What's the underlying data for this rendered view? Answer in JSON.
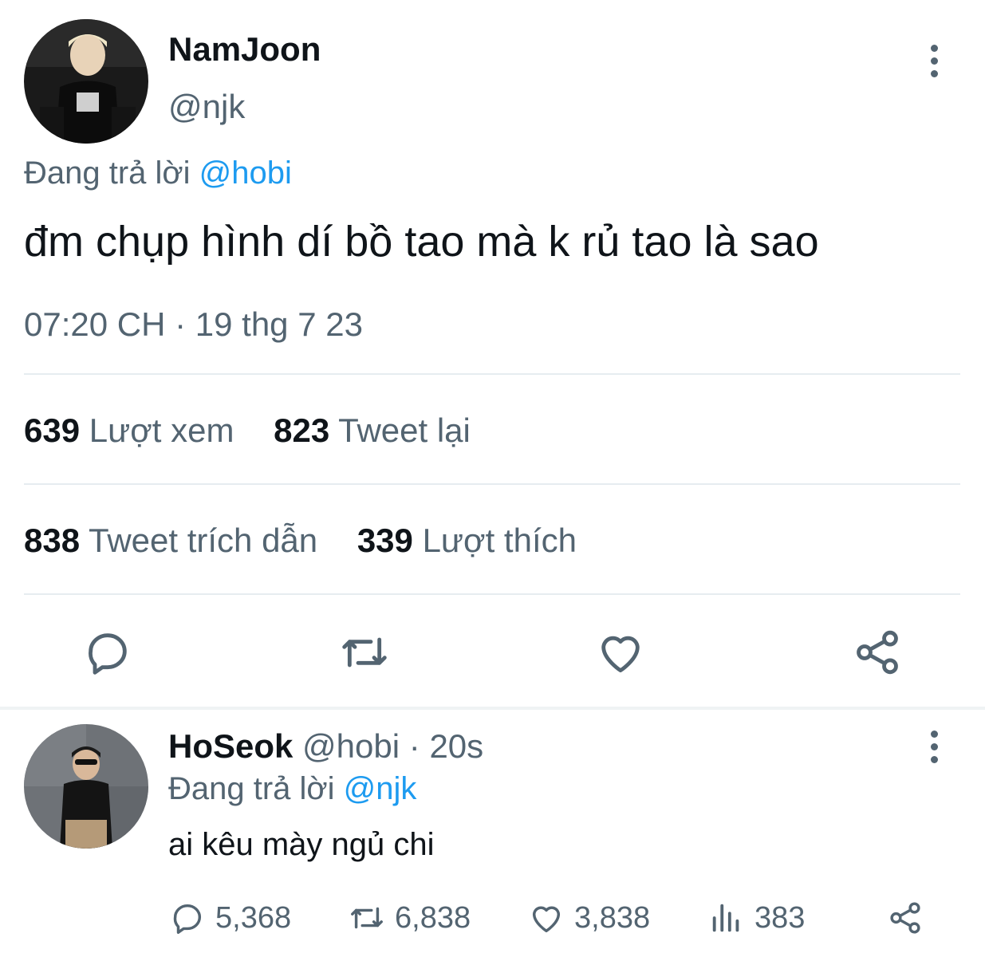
{
  "tweet": {
    "author_name": "NamJoon",
    "author_handle": "@njk",
    "reply_prefix": "Đang trả lời",
    "reply_to": "@hobi",
    "text": "đm chụp hình dí bồ tao mà k rủ tao là sao",
    "timestamp": "07:20 CH · 19 thg 7 23",
    "stats": {
      "views_count": "639",
      "views_label": "Lượt xem",
      "retweets_count": "823",
      "retweets_label": "Tweet lại",
      "quotes_count": "838",
      "quotes_label": "Tweet trích dẫn",
      "likes_count": "339",
      "likes_label": "Lượt thích"
    },
    "actions": [
      "reply-icon",
      "retweet-icon",
      "like-icon",
      "share-icon"
    ]
  },
  "reply": {
    "author_name": "HoSeok",
    "author_handle": "@hobi",
    "separator": "·",
    "time": "20s",
    "reply_prefix": "Đang trả lời",
    "reply_to": "@njk",
    "text": "ai kêu mày ngủ chi",
    "stats": {
      "replies": "5,368",
      "retweets": "6,838",
      "likes": "3,838",
      "views": "383"
    }
  },
  "colors": {
    "text_primary": "#0f1419",
    "text_secondary": "#536471",
    "accent": "#1d9bf0",
    "divider": "#e6ecf0"
  }
}
